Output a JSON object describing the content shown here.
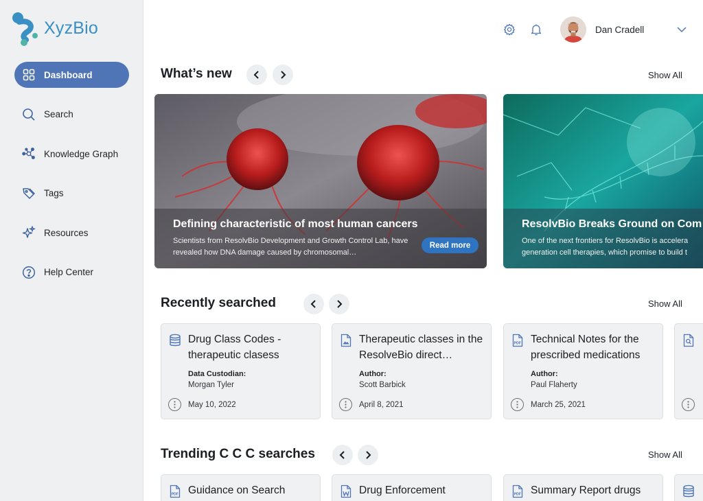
{
  "brand": {
    "name": "XyzBio"
  },
  "sidebar": {
    "items": [
      {
        "label": "Dashboard",
        "icon": "grid-icon",
        "active": true
      },
      {
        "label": "Search",
        "icon": "search-icon"
      },
      {
        "label": "Knowledge Graph",
        "icon": "graph-icon"
      },
      {
        "label": "Tags",
        "icon": "tag-icon"
      },
      {
        "label": "Resources",
        "icon": "sparkle-icon"
      },
      {
        "label": "Help Center",
        "icon": "help-icon"
      }
    ]
  },
  "header": {
    "user_name": "Dan Cradell"
  },
  "whats_new": {
    "title": "What’s new",
    "show_all": "Show All",
    "cards": [
      {
        "title": "Defining characteristic of most human cancers",
        "description": "Scientists from ResolvBio Development and Growth Control Lab, have revealed how DNA damage caused by chromosomal…",
        "button": "Read more"
      },
      {
        "title": "ResolvBio Breaks Ground on Com",
        "description": "One of the next frontiers for ResolvBio is accelera generation cell therapies, which promise to build t"
      }
    ]
  },
  "recently_searched": {
    "title": "Recently searched",
    "show_all": "Show All",
    "cards": [
      {
        "icon": "database-icon",
        "title": "Drug Class Codes - therapeutic clasess",
        "label": "Data Custodian:",
        "value": "Morgan Tyler",
        "date": "May 10, 2022"
      },
      {
        "icon": "image-file-icon",
        "title": "Therapeutic classes in the ResolveBio direct…",
        "label": "Author:",
        "value": "Scott Barbick",
        "date": "April 8, 2021"
      },
      {
        "icon": "pdf-file-icon",
        "title": "Technical Notes for the prescribed medications",
        "label": "Author:",
        "value": "Paul Flaherty",
        "date": "March 25, 2021"
      },
      {
        "icon": "search-file-icon",
        "title": "",
        "label": "",
        "value": "",
        "date": ""
      }
    ]
  },
  "trending": {
    "title": "Trending C C C searches",
    "show_all": "Show All",
    "cards": [
      {
        "icon": "pdf-file-icon",
        "title": "Guidance on Search"
      },
      {
        "icon": "word-file-icon",
        "title": "Drug Enforcement"
      },
      {
        "icon": "pdf-file-icon",
        "title": "Summary Report drugs"
      },
      {
        "icon": "database-icon",
        "title": ""
      }
    ]
  },
  "colors": {
    "accent": "#4f75b7",
    "brand": "#3a8fc4",
    "button": "#2f74c0",
    "sidebar_bg": "#eef0f1"
  }
}
